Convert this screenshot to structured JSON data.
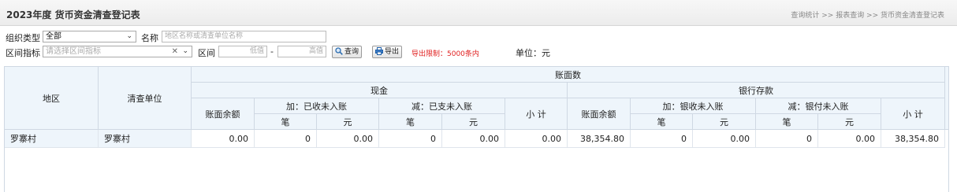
{
  "page": {
    "title": "2023年度 货币资金清查登记表",
    "breadcrumb": "查询统计 >> 报表查询 >> 货币资金清查登记表"
  },
  "filter": {
    "org_type_label": "组织类型",
    "org_type_value": "全部",
    "name_label": "名称",
    "name_placeholder": "地区名称或清查单位名称",
    "range_indicator_label": "区间指标",
    "range_indicator_placeholder": "请选择区间指标",
    "range_label": "区间",
    "low_placeholder": "低值",
    "range_sep": "-",
    "high_placeholder": "高值",
    "query_button": "查询",
    "export_button": "导出",
    "export_limit": "导出限制：5000条内",
    "unit_label": "单位：元"
  },
  "table": {
    "headers": {
      "region": "地区",
      "unit": "清查单位",
      "book": "账面数",
      "cash": "现金",
      "bank": "银行存款",
      "cash_balance": "账面余额",
      "cash_plus": "加：已收未入账",
      "cash_minus": "减：已支未入账",
      "cash_subtotal": "小 计",
      "bank_balance": "账面余额",
      "bank_plus": "加：银收未入账",
      "bank_minus": "减：银付未入账",
      "bank_subtotal": "小 计",
      "count": "笔",
      "yuan": "元"
    },
    "rows": [
      {
        "region": "罗寨村",
        "unit": "罗寨村",
        "cash_balance": "0.00",
        "cash_plus_count": "0",
        "cash_plus_amount": "0.00",
        "cash_minus_count": "0",
        "cash_minus_amount": "0.00",
        "cash_subtotal": "0.00",
        "bank_balance": "38,354.80",
        "bank_plus_count": "0",
        "bank_plus_amount": "0.00",
        "bank_minus_count": "0",
        "bank_minus_amount": "0.00",
        "bank_subtotal": "38,354.80"
      }
    ]
  }
}
